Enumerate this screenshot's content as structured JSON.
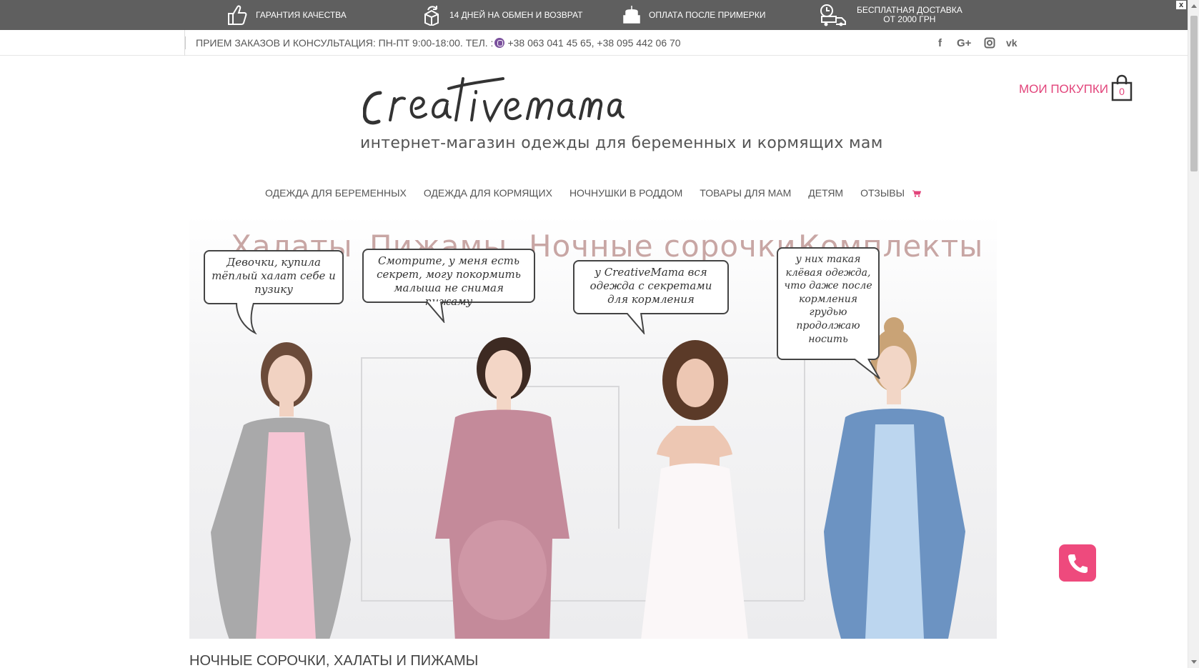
{
  "promo": {
    "items": [
      {
        "icon": "thumbs-up-icon",
        "text": "ГАРАНТИЯ КАЧЕСТВА"
      },
      {
        "icon": "return-box-icon",
        "text": "14 ДНЕЙ НА ОБМЕН И ВОЗВРАТ"
      },
      {
        "icon": "cake-payment-icon",
        "text": "ОПЛАТА ПОСЛЕ ПРИМЕРКИ"
      },
      {
        "icon": "delivery-truck-icon",
        "line1": "БЕСПЛАТНАЯ ДОСТАВКА",
        "line2": "ОТ 2000 ГРН"
      }
    ],
    "close": "x"
  },
  "contact": {
    "label": "ПРИЕМ ЗАКАЗОВ И КОНСУЛЬТАЦИЯ: ПН-ПТ 9:00-18:00. ТЕЛ. :",
    "phones": "+38 063 041 45 65, +38 095 442 06 70"
  },
  "social": {
    "facebook": "f",
    "googleplus": "G+",
    "instagram": "instagram-icon",
    "vk": "vk"
  },
  "logo": {
    "tagline": "интернет-магазин одежды для беременных и кормящих мам"
  },
  "cart": {
    "label": "МОИ ПОКУПКИ",
    "count": "0"
  },
  "nav": [
    "ОДЕЖДА ДЛЯ БЕРЕМЕННЫХ",
    "ОДЕЖДА ДЛЯ КОРМЯЩИХ",
    "НОЧНУШКИ В РОДДОМ",
    "ТОВАРЫ ДЛЯ МАМ",
    "ДЕТЯМ",
    "ОТЗЫВЫ"
  ],
  "banner": {
    "categories": [
      "Халаты",
      "Пижамы",
      "Ночные сорочки",
      "Комплекты"
    ],
    "bubbles": [
      "Девочки, купила тёплый халат себе и пузику",
      "Смотрите, у меня есть секрет, могу покормить малыша не снимая пижаму",
      "у CreativeMama вся одежда с секретами для кормления",
      "у них такая клёвая одежда, что даже после кормления грудью продолжаю носить"
    ],
    "colors": {
      "robe_gray": "#a9a9aa",
      "nightgown_pink": "#f6c5d4",
      "pajama_mauve": "#c48a9a",
      "dress_white": "#fbf7f8",
      "robe_blue": "#6c93c2",
      "dress_lightblue": "#bcd6ef"
    }
  },
  "section": {
    "title": "НОЧНЫЕ СОРОЧКИ, ХАЛАТЫ И ПИЖАМЫ"
  },
  "accent_color": "#e2437a",
  "call_button_color": "#ee4a7d"
}
